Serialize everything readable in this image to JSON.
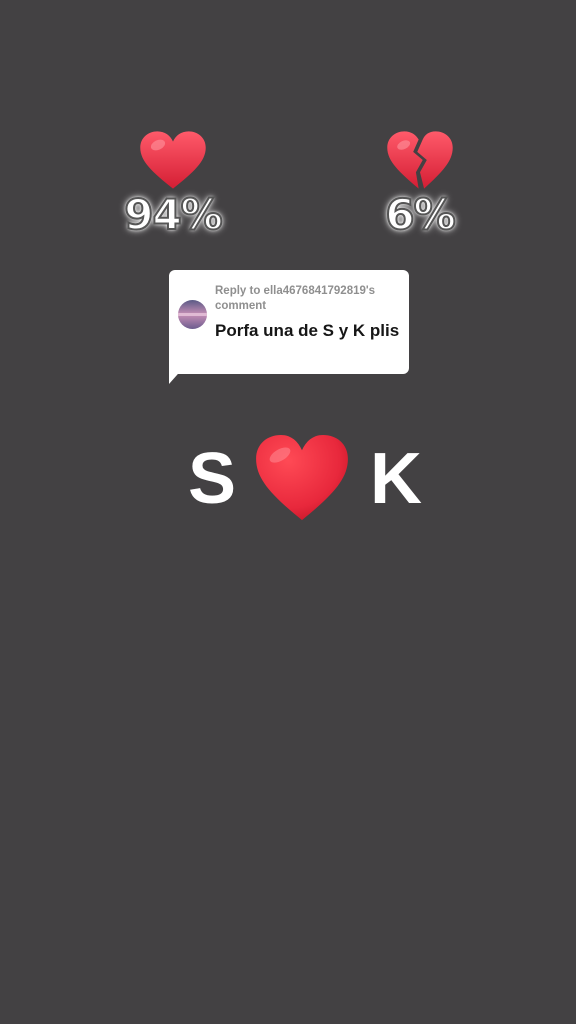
{
  "match": {
    "love": {
      "percent": "94%",
      "icon": "red-heart-icon",
      "color": "#e8283c"
    },
    "broken": {
      "percent": "6%",
      "icon": "broken-heart-icon",
      "color": "#e8283c"
    }
  },
  "comment": {
    "reply_to": "Reply to ella4676841792819's comment",
    "text": "Porfa una de S y K plis"
  },
  "pair": {
    "left": "S",
    "right": "K",
    "heart_icon": "red-heart-icon"
  },
  "colors": {
    "background": "#434143",
    "heart": "#e8283c"
  }
}
